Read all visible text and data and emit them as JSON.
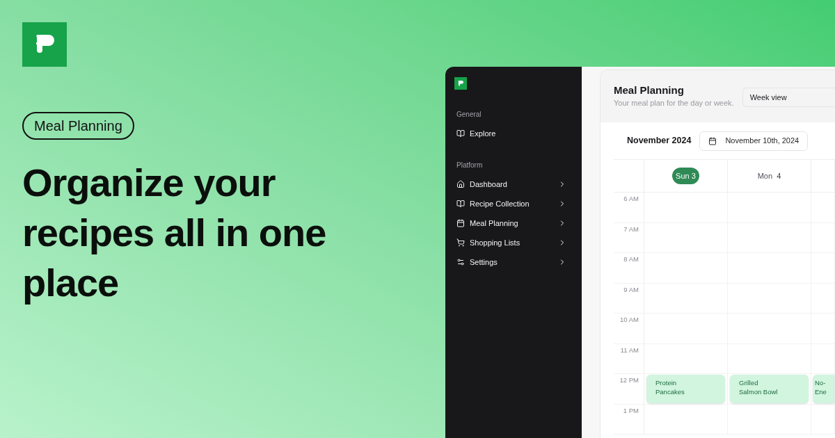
{
  "hero": {
    "tag": "Meal Planning",
    "headline": "Organize your recipes all in one place"
  },
  "sidebar": {
    "sections": [
      {
        "heading": "General",
        "items": [
          {
            "label": "Explore",
            "expandable": false
          }
        ]
      },
      {
        "heading": "Platform",
        "items": [
          {
            "label": "Dashboard",
            "expandable": true
          },
          {
            "label": "Recipe Collection",
            "expandable": true
          },
          {
            "label": "Meal Planning",
            "expandable": true
          },
          {
            "label": "Shopping Lists",
            "expandable": true
          },
          {
            "label": "Settings",
            "expandable": true
          }
        ]
      }
    ]
  },
  "page": {
    "title": "Meal Planning",
    "subtitle": "Your meal plan for the day or week.",
    "view_select": "Week view"
  },
  "calendar": {
    "month": "November 2024",
    "date_picker": "November 10th, 2024",
    "days": [
      {
        "day": "Sun",
        "date": "3",
        "selected": true
      },
      {
        "day": "Mon",
        "date": "4",
        "selected": false
      }
    ],
    "hours": [
      {
        "time": "6 AM"
      },
      {
        "time": "7 AM"
      },
      {
        "time": "8 AM"
      },
      {
        "time": "9 AM"
      },
      {
        "time": "10 AM"
      },
      {
        "time": "11 AM"
      },
      {
        "time": "12 PM",
        "events": [
          {
            "lines": [
              "Protein",
              "Pancakes"
            ]
          },
          {
            "lines": [
              "Grilled",
              "Salmon Bowl"
            ]
          },
          {
            "lines": [
              "No-",
              "Ene"
            ]
          }
        ]
      },
      {
        "time": "1 PM"
      }
    ]
  }
}
